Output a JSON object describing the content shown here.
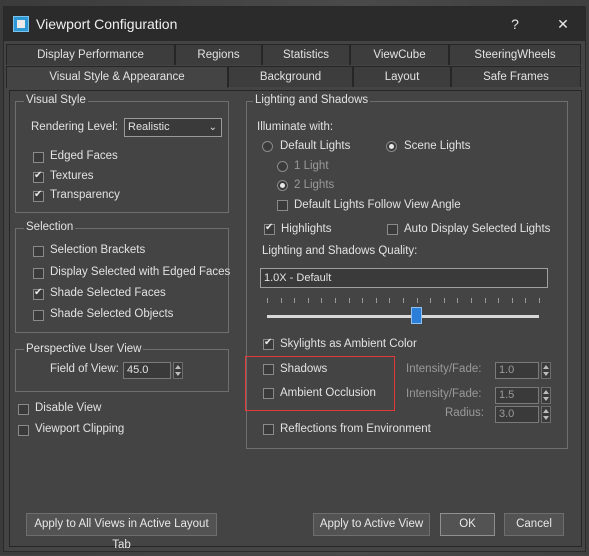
{
  "dialog": {
    "title": "Viewport Configuration",
    "help_label": "?",
    "close_label": "✕"
  },
  "tabs_row1": [
    "Display Performance",
    "Regions",
    "Statistics",
    "ViewCube",
    "SteeringWheels"
  ],
  "tabs_row2": [
    "Visual Style & Appearance",
    "Background",
    "Layout",
    "Safe Frames"
  ],
  "active_tab": "Visual Style & Appearance",
  "visual_style": {
    "group_label": "Visual Style",
    "rendering_level_label": "Rendering Level:",
    "rendering_level_value": "Realistic",
    "edged_faces": {
      "label": "Edged Faces",
      "checked": false
    },
    "textures": {
      "label": "Textures",
      "checked": true
    },
    "transparency": {
      "label": "Transparency",
      "checked": true
    }
  },
  "selection": {
    "group_label": "Selection",
    "items": [
      {
        "label": "Selection Brackets",
        "checked": false
      },
      {
        "label": "Display Selected with Edged Faces",
        "checked": false
      },
      {
        "label": "Shade Selected Faces",
        "checked": true
      },
      {
        "label": "Shade Selected Objects",
        "checked": false
      }
    ]
  },
  "perspective": {
    "group_label": "Perspective User View",
    "fov_label": "Field of View:",
    "fov_value": "45.0"
  },
  "disable_view": {
    "label": "Disable View",
    "checked": false
  },
  "viewport_clipping": {
    "label": "Viewport Clipping",
    "checked": false
  },
  "lighting": {
    "group_label": "Lighting and Shadows",
    "illuminate_label": "Illuminate with:",
    "default_lights": {
      "label": "Default Lights",
      "selected": false
    },
    "scene_lights": {
      "label": "Scene Lights",
      "selected": true
    },
    "one_light": {
      "label": "1 Light",
      "selected": false
    },
    "two_lights": {
      "label": "2 Lights",
      "selected": true
    },
    "default_follow": {
      "label": "Default Lights Follow View Angle",
      "checked": false
    },
    "highlights": {
      "label": "Highlights",
      "checked": true
    },
    "auto_display": {
      "label": "Auto Display Selected Lights",
      "checked": false
    },
    "quality_label": "Lighting and Shadows Quality:",
    "quality_value": "1.0X - Default",
    "quality_slider_fraction": 0.55,
    "skylights": {
      "label": "Skylights as Ambient Color",
      "checked": true
    },
    "shadows": {
      "label": "Shadows",
      "checked": false
    },
    "ambient_occlusion": {
      "label": "Ambient Occlusion",
      "checked": false
    },
    "shadow_intensity_label": "Intensity/Fade:",
    "shadow_intensity_value": "1.0",
    "ao_intensity_label": "Intensity/Fade:",
    "ao_intensity_value": "1.5",
    "radius_label": "Radius:",
    "radius_value": "3.0",
    "reflections": {
      "label": "Reflections from Environment",
      "checked": false
    }
  },
  "buttons": {
    "apply_all": "Apply to All Views in Active Layout Tab",
    "apply_active": "Apply to Active View",
    "ok": "OK",
    "cancel": "Cancel"
  },
  "colors": {
    "highlight_box": "#e03a3a",
    "slider_thumb": "#2b7fd8",
    "title_bar": "#2b2b2b"
  }
}
